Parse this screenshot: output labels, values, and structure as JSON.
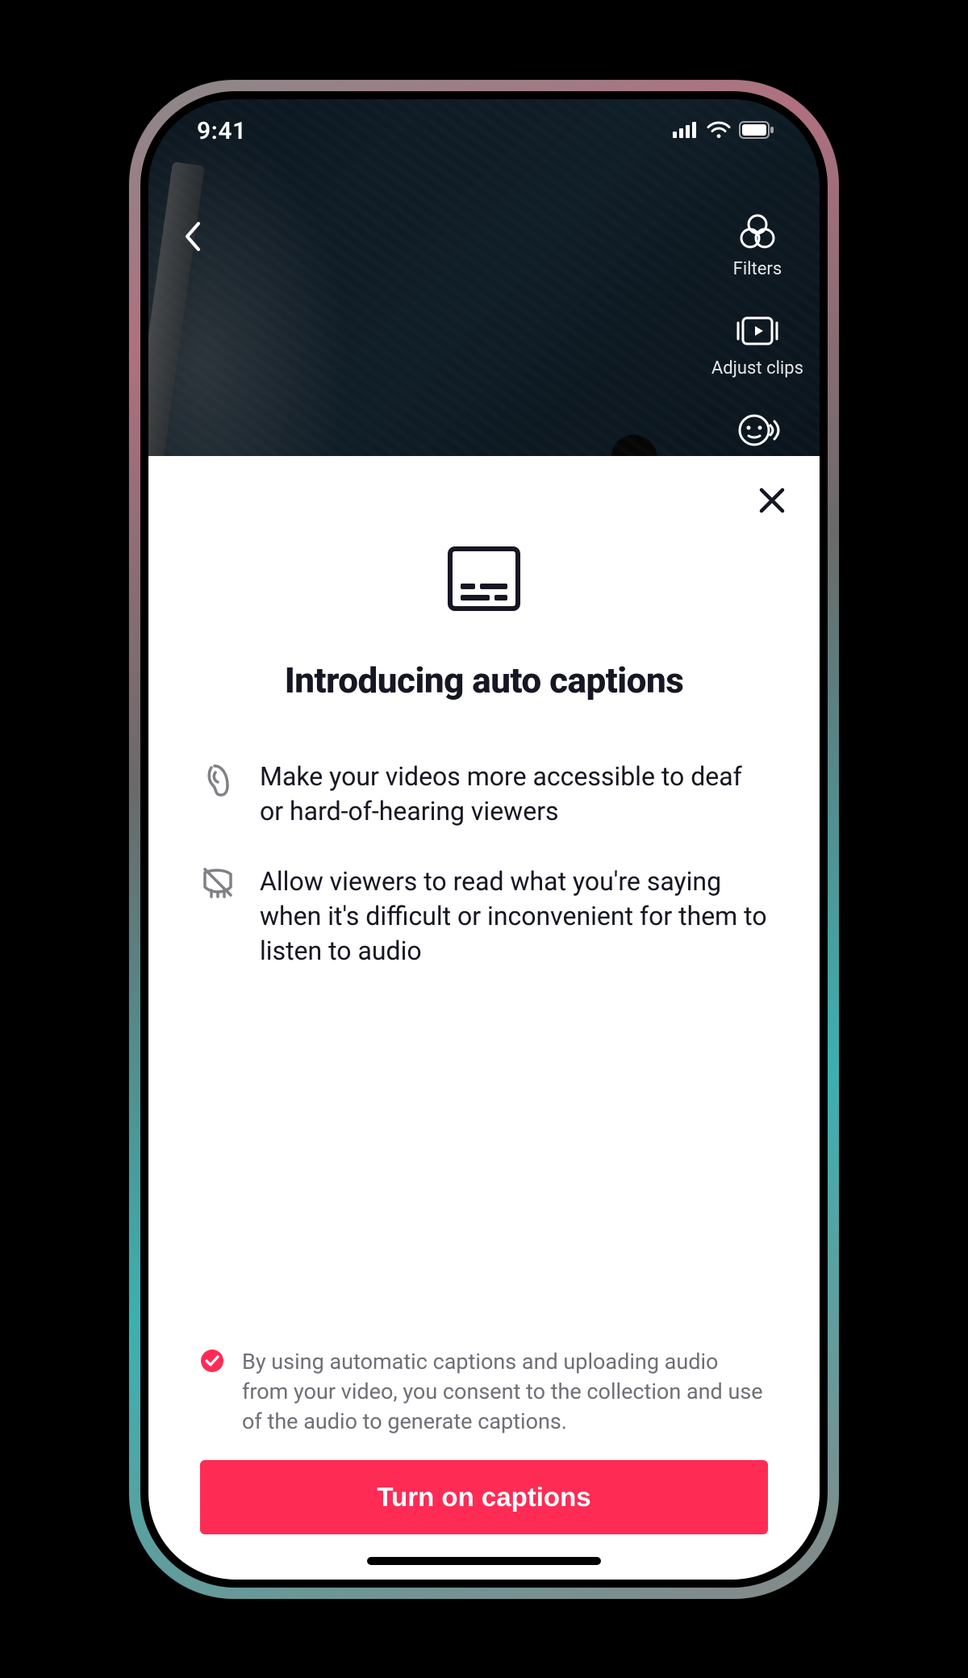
{
  "status": {
    "time": "9:41"
  },
  "editor": {
    "tools": {
      "filters": "Filters",
      "adjust_clips": "Adjust clips"
    }
  },
  "sheet": {
    "title": "Introducing auto captions",
    "benefits": [
      "Make your videos more accessible to deaf or hard-of-hearing viewers",
      "Allow viewers to read what you're saying when it's difficult or inconvenient for them to listen to audio"
    ],
    "consent": "By using automatic captions and uploading audio from your video, you consent to the collection and use of the audio to generate captions.",
    "cta": "Turn on captions"
  },
  "colors": {
    "accent": "#fe2c55"
  }
}
